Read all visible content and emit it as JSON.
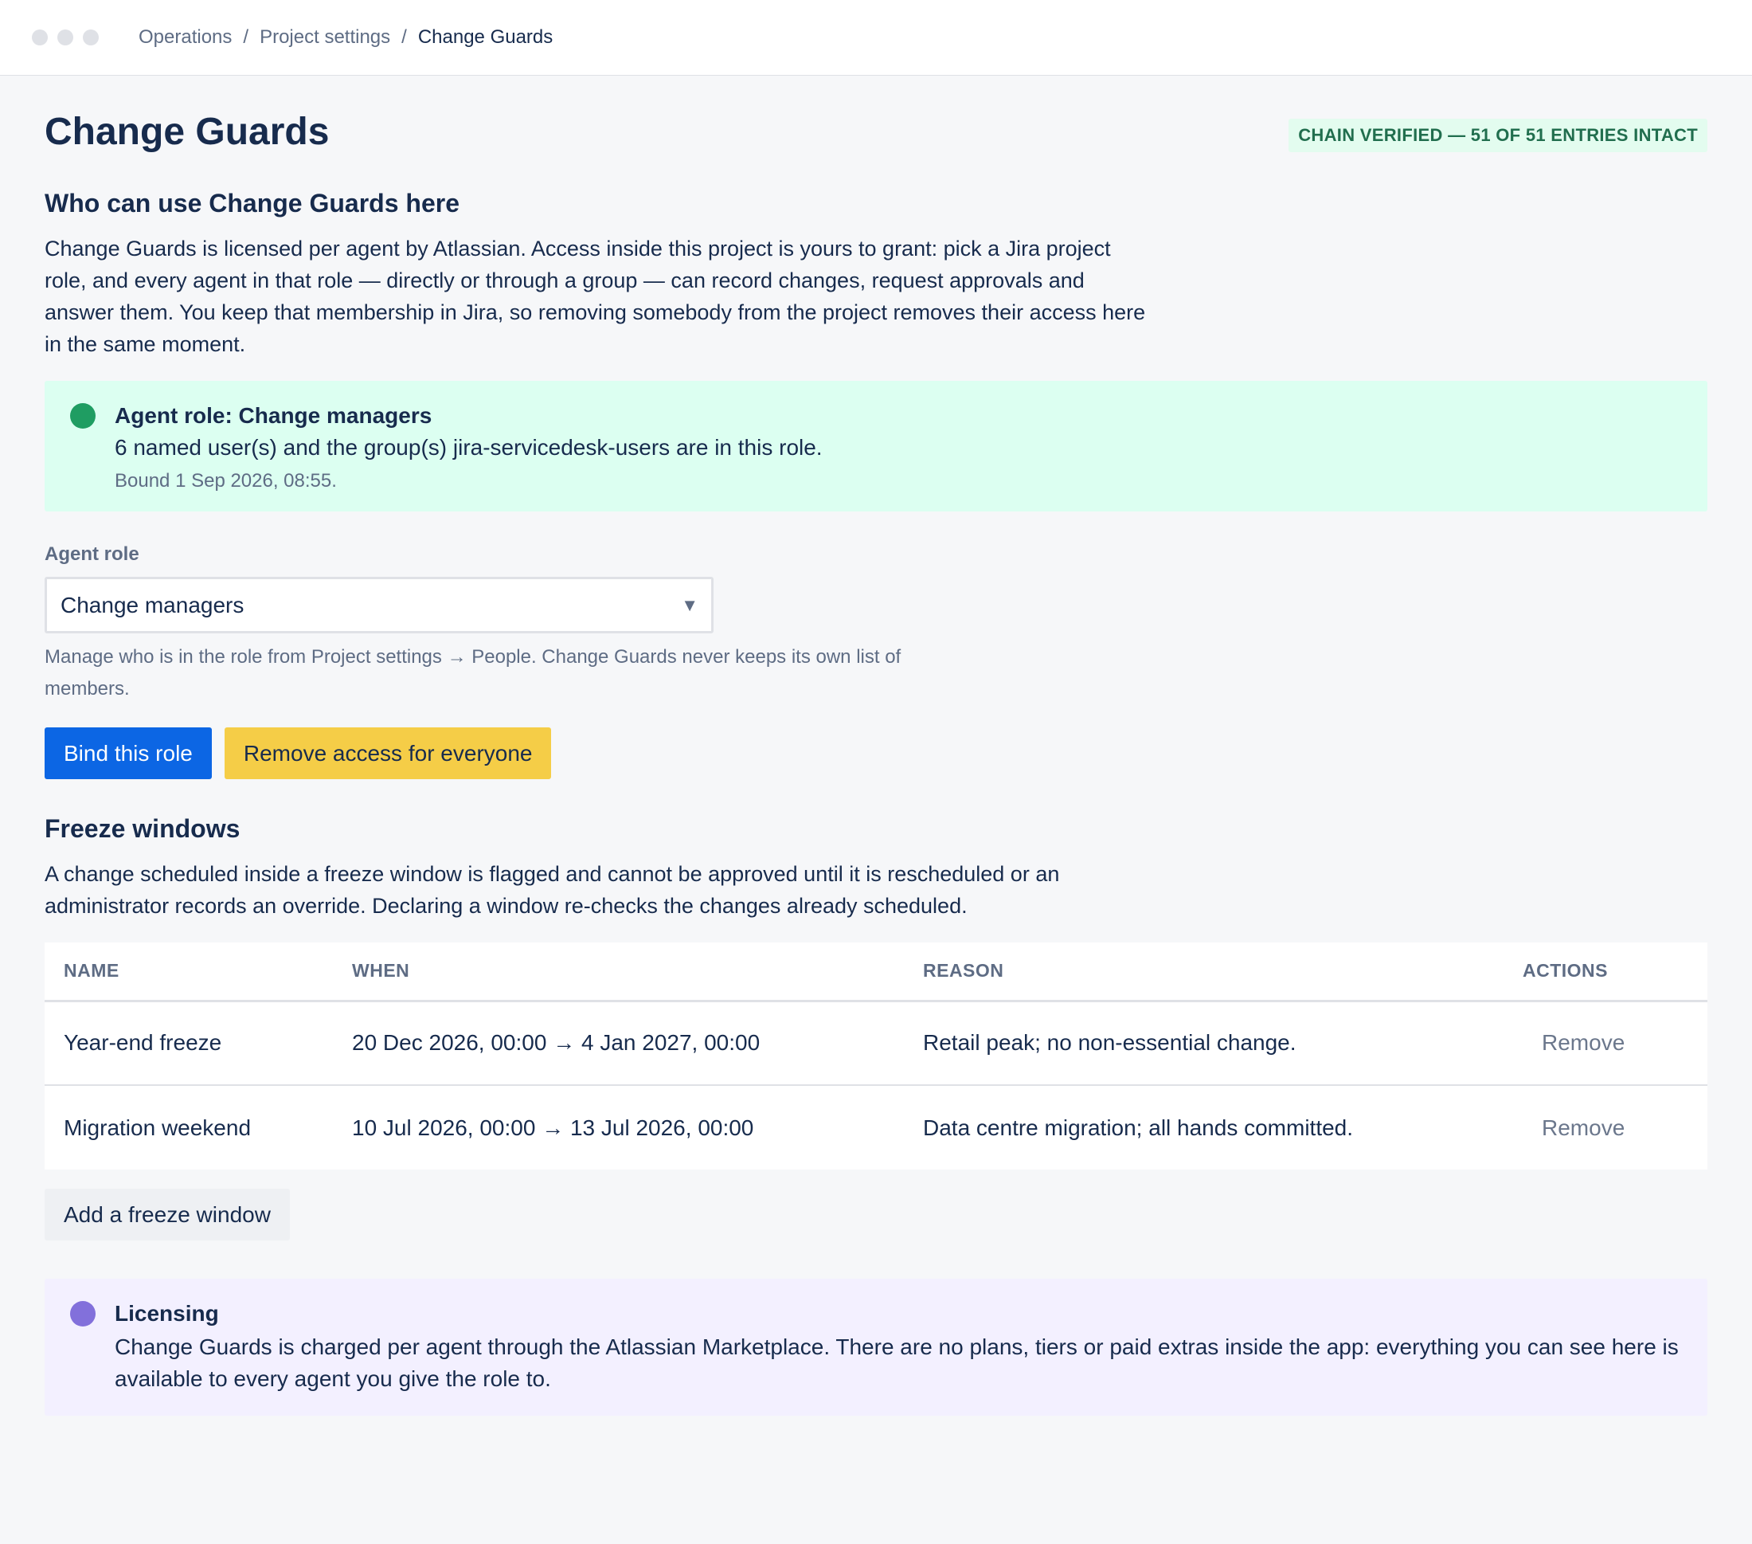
{
  "breadcrumb": {
    "items": [
      "Operations",
      "Project settings"
    ],
    "current": "Change Guards",
    "separator": "/"
  },
  "page": {
    "title": "Change Guards",
    "verified_badge": "CHAIN VERIFIED — 51 OF 51 ENTRIES INTACT"
  },
  "access": {
    "heading": "Who can use Change Guards here",
    "description": "Change Guards is licensed per agent by Atlassian. Access inside this project is yours to grant: pick a Jira project role, and every agent in that role — directly or through a group — can record changes, request approvals and answer them. You keep that membership in Jira, so removing somebody from the project removes their access here in the same moment.",
    "status": {
      "title": "Agent role: Change managers",
      "text": "6 named user(s) and the group(s) jira-servicedesk-users are in this role.",
      "meta": "Bound 1 Sep 2026, 08:55.",
      "color": "#1f9d62"
    },
    "field_label": "Agent role",
    "selected_role": "Change managers",
    "help": "Manage who is in the role from Project settings → People. Change Guards never keeps its own list of members.",
    "bind_label": "Bind this role",
    "remove_label": "Remove access for everyone"
  },
  "freeze": {
    "heading": "Freeze windows",
    "description": "A change scheduled inside a freeze window is flagged and cannot be approved until it is rescheduled or an administrator records an override. Declaring a window re-checks the changes already scheduled.",
    "columns": [
      "NAME",
      "WHEN",
      "REASON",
      "ACTIONS"
    ],
    "rows": [
      {
        "name": "Year-end freeze",
        "when": "20 Dec 2026, 00:00 → 4 Jan 2027, 00:00",
        "reason": "Retail peak; no non-essential change.",
        "action": "Remove"
      },
      {
        "name": "Migration weekend",
        "when": "10 Jul 2026, 00:00 → 13 Jul 2026, 00:00",
        "reason": "Data centre migration; all hands committed.",
        "action": "Remove"
      }
    ],
    "add_label": "Add a freeze window"
  },
  "licensing": {
    "title": "Licensing",
    "text": "Change Guards is charged per agent through the Atlassian Marketplace. There are no plans, tiers or paid extras inside the app: everything you can see here is available to every agent you give the role to.",
    "color": "#8270db"
  },
  "colors": {
    "primary": "#0c66e4",
    "warning": "#f5cd47",
    "success_bg": "#dcfff1",
    "info_bg": "#f3f0ff"
  }
}
